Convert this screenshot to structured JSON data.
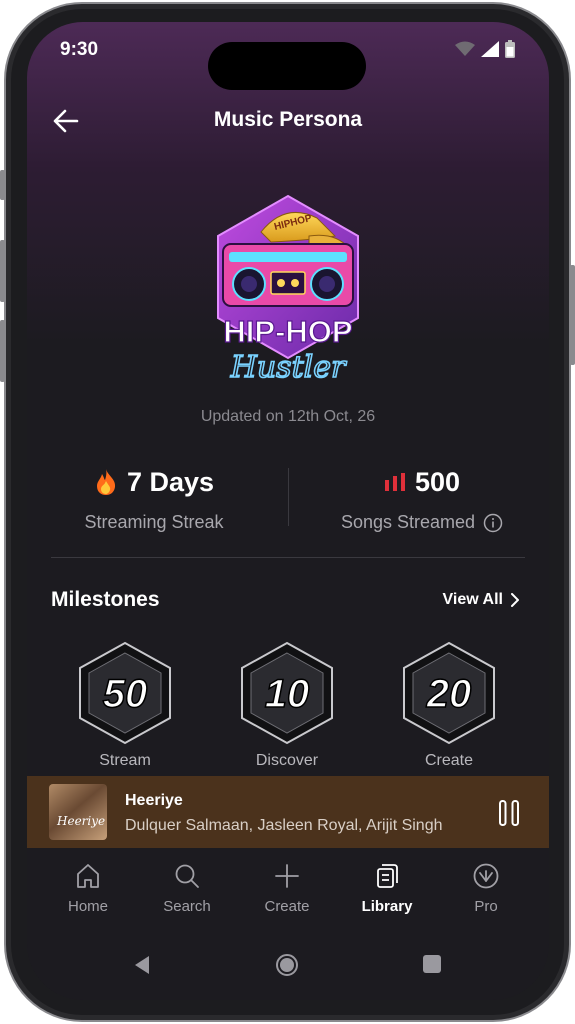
{
  "status": {
    "time": "9:30"
  },
  "header": {
    "title": "Music Persona"
  },
  "persona": {
    "top_text": "HIPHOP",
    "title_line1": "HIP-HOP",
    "title_line2": "Hustler",
    "updated": "Updated on 12th Oct, 26"
  },
  "stats": {
    "streak": {
      "value": "7 Days",
      "label": "Streaming Streak",
      "icon": "fire-icon"
    },
    "songs": {
      "value": "500",
      "label": "Songs Streamed",
      "icon": "bars-icon",
      "info_icon": "info-icon"
    }
  },
  "milestones": {
    "title": "Milestones",
    "view_all": "View All",
    "items": [
      {
        "number": "50",
        "label": "Stream"
      },
      {
        "number": "10",
        "label": "Discover"
      },
      {
        "number": "20",
        "label": "Create"
      }
    ]
  },
  "player": {
    "art_text": "Heeriye",
    "title": "Heeriye",
    "artists": "Dulquer Salmaan, Jasleen Royal, Arijit Singh"
  },
  "tabs": [
    {
      "label": "Home",
      "icon": "home-icon"
    },
    {
      "label": "Search",
      "icon": "search-icon"
    },
    {
      "label": "Create",
      "icon": "plus-icon"
    },
    {
      "label": "Library",
      "icon": "library-icon",
      "active": true
    },
    {
      "label": "Pro",
      "icon": "pro-icon"
    }
  ],
  "colors": {
    "accent_bar": "#e0303a",
    "player_bg": "#4b321c",
    "screen_bg": "#1c1b20"
  }
}
